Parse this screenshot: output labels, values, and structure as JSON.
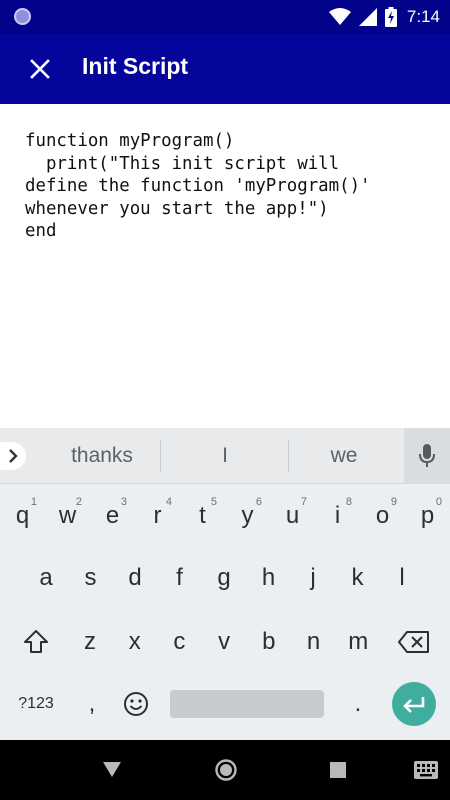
{
  "status_bar": {
    "time": "7:14",
    "icons": [
      "notification-dot",
      "wifi-icon",
      "signal-icon",
      "battery-charging-icon"
    ]
  },
  "app_bar": {
    "title": "Init Script",
    "close_icon": "close-icon"
  },
  "editor": {
    "lines": [
      "function myProgram()",
      "  print(\"This init script will",
      "define the function 'myProgram()'",
      "whenever you start the app!\")",
      "end"
    ]
  },
  "keyboard": {
    "suggestions": [
      "thanks",
      "I",
      "we"
    ],
    "row1": [
      {
        "label": "q",
        "hint": "1"
      },
      {
        "label": "w",
        "hint": "2"
      },
      {
        "label": "e",
        "hint": "3"
      },
      {
        "label": "r",
        "hint": "4"
      },
      {
        "label": "t",
        "hint": "5"
      },
      {
        "label": "y",
        "hint": "6"
      },
      {
        "label": "u",
        "hint": "7"
      },
      {
        "label": "i",
        "hint": "8"
      },
      {
        "label": "o",
        "hint": "9"
      },
      {
        "label": "p",
        "hint": "0"
      }
    ],
    "row2": [
      "a",
      "s",
      "d",
      "f",
      "g",
      "h",
      "j",
      "k",
      "l"
    ],
    "row3": [
      "z",
      "x",
      "c",
      "v",
      "b",
      "n",
      "m"
    ],
    "symbols_label": "?123",
    "comma_label": ",",
    "period_label": ".",
    "accent_color": "#3fae9e"
  },
  "colors": {
    "status_bar": "#02028a",
    "app_bar": "#05059b"
  }
}
